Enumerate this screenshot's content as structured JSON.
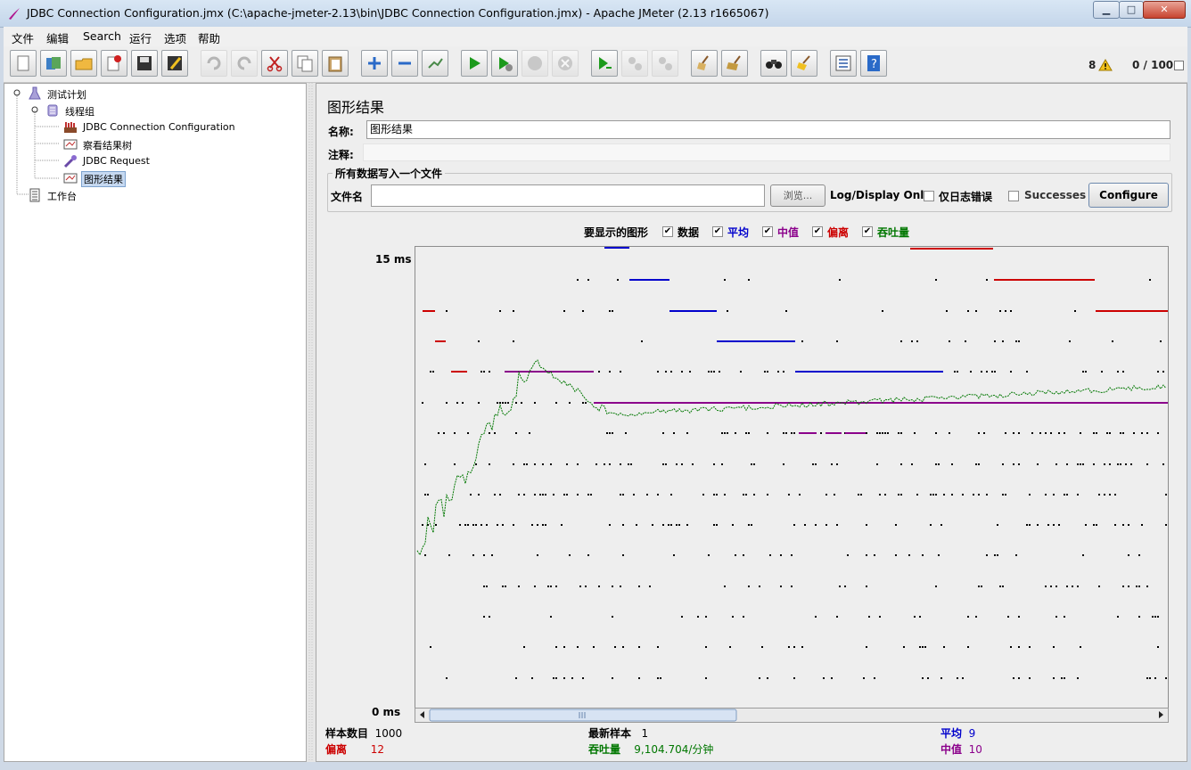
{
  "window": {
    "title": "JDBC Connection Configuration.jmx (C:\\apache-jmeter-2.13\\bin\\JDBC Connection Configuration.jmx) - Apache JMeter (2.13 r1665067)",
    "minimize": "▁",
    "maximize": "□",
    "close": "✕"
  },
  "menu": [
    "文件",
    "编辑",
    "Search",
    "运行",
    "选项",
    "帮助"
  ],
  "toolbar": {
    "warning_count": "8",
    "thread_count": "0 / 100"
  },
  "tree": {
    "items": [
      {
        "label": "测试计划",
        "icon": "test-plan-icon"
      },
      {
        "label": "线程组",
        "icon": "thread-group-icon"
      },
      {
        "label": "JDBC Connection Configuration",
        "icon": "jdbc-config-icon"
      },
      {
        "label": "察看结果树",
        "icon": "listener-icon"
      },
      {
        "label": "JDBC Request",
        "icon": "sampler-icon"
      },
      {
        "label": "图形结果",
        "icon": "listener-icon"
      },
      {
        "label": "工作台",
        "icon": "workbench-icon"
      }
    ]
  },
  "panel": {
    "title": "图形结果",
    "name_label": "名称:",
    "name_value": "图形结果",
    "comment_label": "注释:",
    "comment_value": "",
    "group_title": "所有数据写入一个文件",
    "filename_label": "文件名",
    "filename_value": "",
    "browse": "浏览...",
    "log_label": "Log/Display Only:",
    "errors_only": "仅日志错误",
    "successes": "Successes",
    "configure": "Configure"
  },
  "graph_options": {
    "label": "要显示的图形",
    "items": [
      {
        "label": "数据",
        "checked": true,
        "color": "#000000"
      },
      {
        "label": "平均",
        "checked": true,
        "color": "#0000cc"
      },
      {
        "label": "中值",
        "checked": true,
        "color": "#8b008b"
      },
      {
        "label": "偏离",
        "checked": true,
        "color": "#cc0000"
      },
      {
        "label": "吞吐量",
        "checked": true,
        "color": "#007700"
      }
    ]
  },
  "axis": {
    "top": "15 ms",
    "bottom": "0 ms"
  },
  "stats": {
    "samples_label": "样本数目",
    "samples_value": "1000",
    "latest_label": "最新样本",
    "latest_value": "1",
    "average_label": "平均",
    "average_value": "9",
    "deviation_label": "偏离",
    "deviation_value": "12",
    "throughput_label": "吞吐量",
    "throughput_value": "9,104.704/分钟",
    "median_label": "中值",
    "median_value": "10"
  },
  "colors": {
    "data": "#000000",
    "average": "#0000cc",
    "median": "#8b008b",
    "deviation": "#cc0000",
    "throughput": "#007700"
  }
}
